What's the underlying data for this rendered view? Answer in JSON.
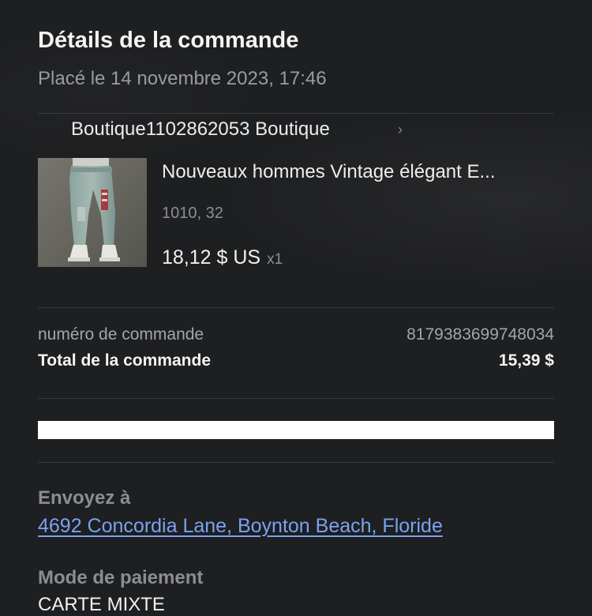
{
  "order": {
    "title": "Détails de la commande",
    "placed": "Placé le 14 novembre 2023, 17:46"
  },
  "shop": {
    "name": "Boutique1102862053 Boutique",
    "chevron_icon": "chevron-right-icon"
  },
  "item": {
    "title": "Nouveaux hommes Vintage élégant E...",
    "variant": "1010, 32",
    "price": "18,12 $ US",
    "quantity": "x1",
    "image": "jeans-product-thumbnail"
  },
  "summary": {
    "order_number_label": "numéro de commande",
    "order_number_value": "8179383699748034",
    "total_label": "Total de la commande",
    "total_value": "15,39 $"
  },
  "shipping": {
    "heading": "Envoyez à",
    "address": "4692 Concordia Lane, Boynton Beach, Floride"
  },
  "payment": {
    "heading": "Mode de paiement",
    "method": "CARTE MIXTE"
  },
  "colors": {
    "background": "#1e1f21",
    "link": "#7aa2f0",
    "muted_text": "#a4a5a8",
    "divider": "#38393c"
  }
}
